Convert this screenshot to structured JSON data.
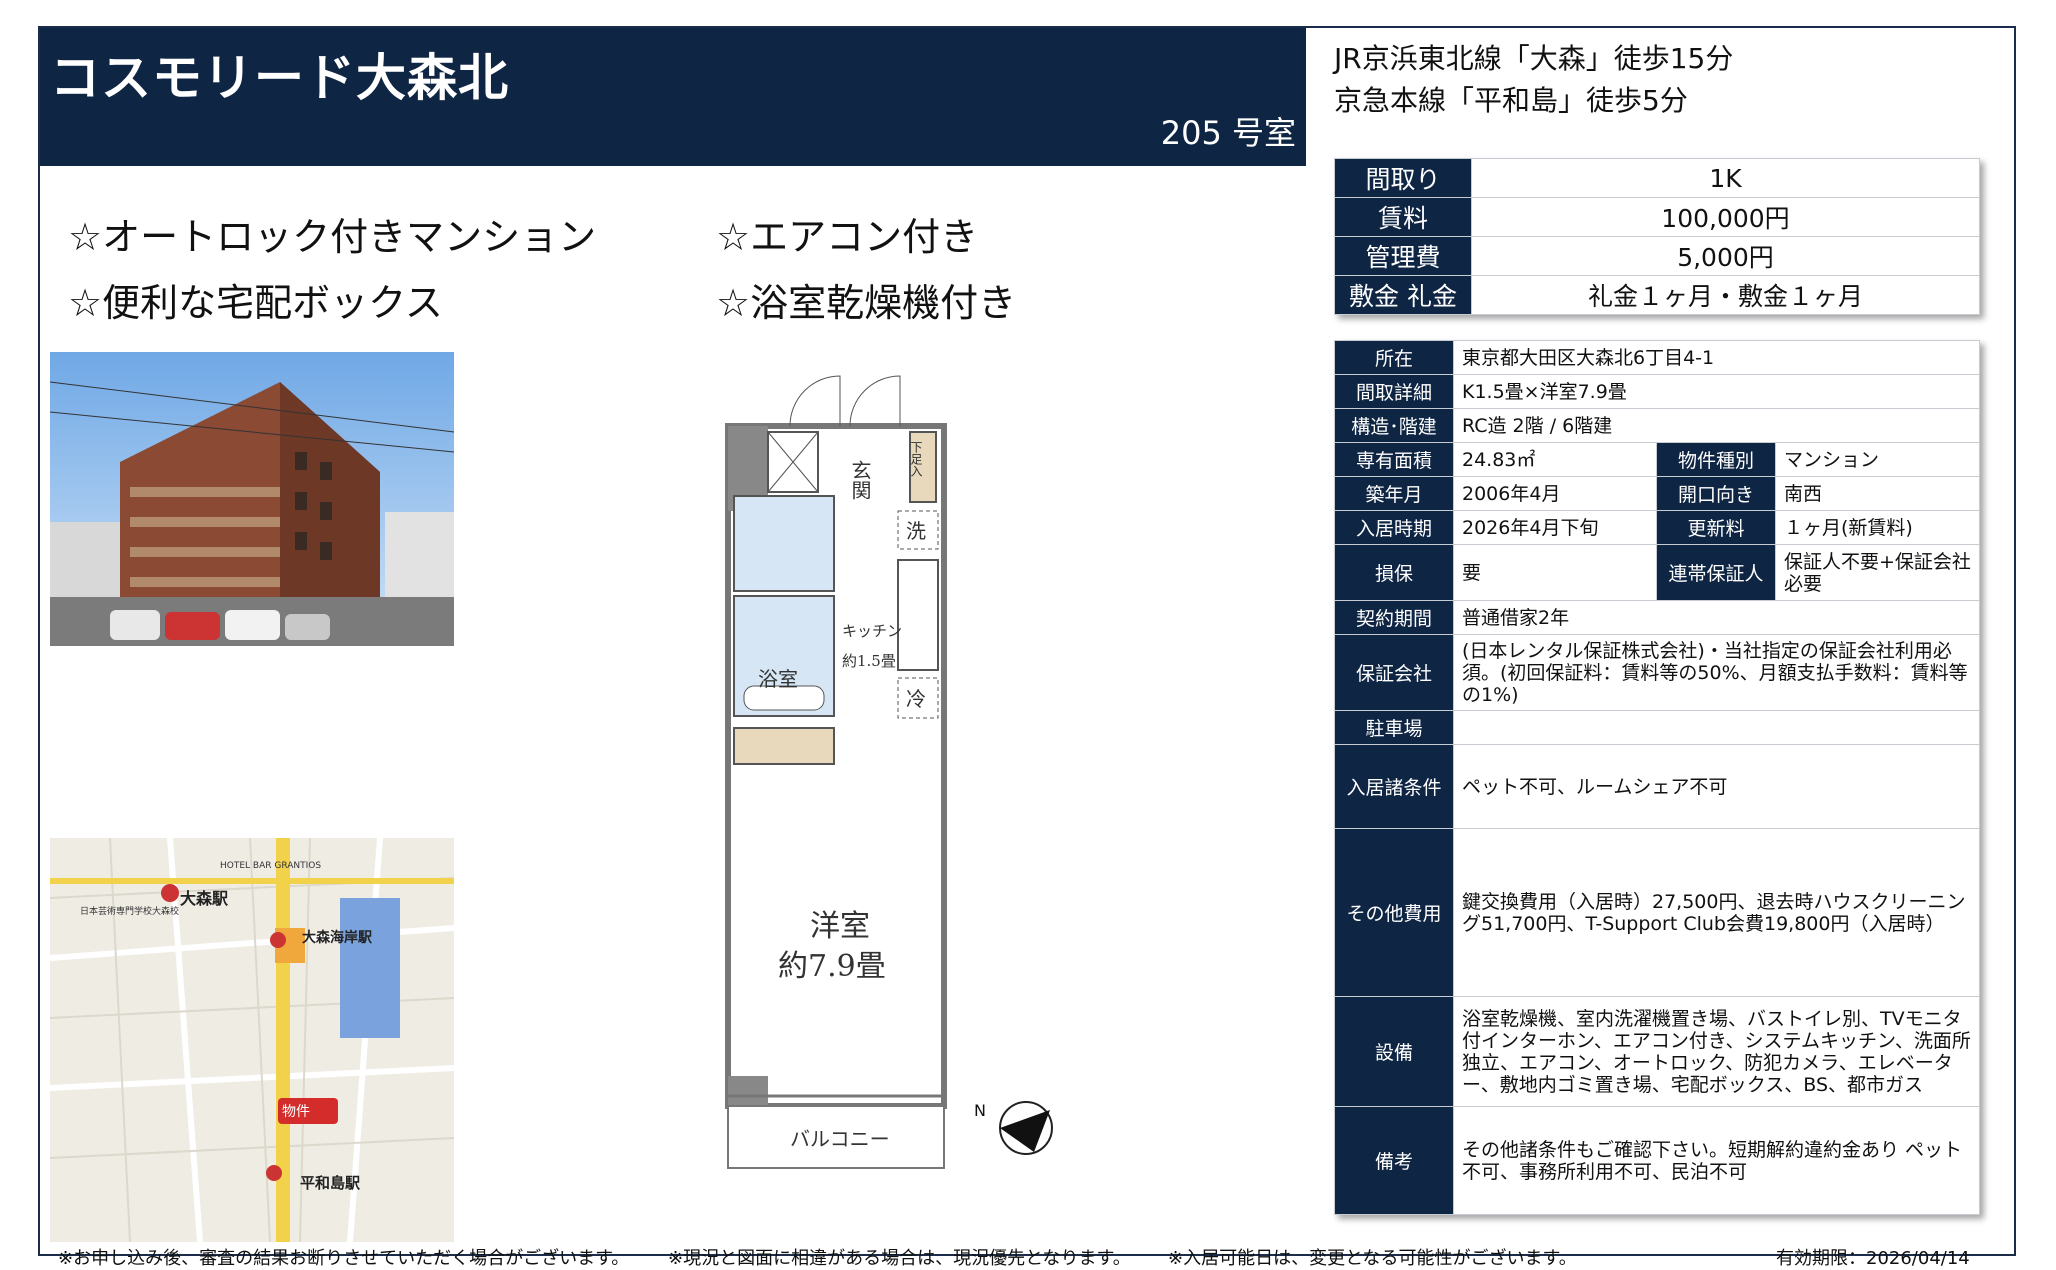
{
  "header": {
    "title": "コスモリード大森北",
    "room": "205 号室"
  },
  "access": [
    "JR京浜東北線「大森」徒歩15分",
    "京急本線「平和島」徒歩5分"
  ],
  "features": [
    "☆オートロック付きマンション",
    "☆エアコン付き",
    "☆便利な宅配ボックス",
    "☆浴室乾燥機付き"
  ],
  "summary": [
    {
      "label": "間取り",
      "value": "1K"
    },
    {
      "label": "賃料",
      "value": "100,000円"
    },
    {
      "label": "管理費",
      "value": "5,000円"
    },
    {
      "label": "敷金 礼金",
      "value": "礼金１ヶ月・敷金１ヶ月"
    }
  ],
  "details": {
    "address": {
      "label": "所在",
      "value": "東京都大田区大森北6丁目4-1"
    },
    "layout_detail": {
      "label": "間取詳細",
      "value": "K1.5畳×洋室7.9畳"
    },
    "structure": {
      "label": "構造･階建",
      "value": "RC造 2階 / 6階建"
    },
    "area": {
      "label": "専有面積",
      "value": "24.83㎡"
    },
    "type": {
      "label": "物件種別",
      "value": "マンション"
    },
    "built": {
      "label": "築年月",
      "value": "2006年4月"
    },
    "direction": {
      "label": "開口向き",
      "value": "南西"
    },
    "move_in": {
      "label": "入居時期",
      "value": "2026年4月下旬"
    },
    "renewal": {
      "label": "更新料",
      "value": "１ヶ月(新賃料)"
    },
    "insurance": {
      "label": "損保",
      "value": "要"
    },
    "guarantor": {
      "label": "連帯保証人",
      "value": "保証人不要+保証会社必要"
    },
    "contract": {
      "label": "契約期間",
      "value": "普通借家2年"
    },
    "guarantee_company": {
      "label": "保証会社",
      "value": "(日本レンタル保証株式会社)・当社指定の保証会社利用必須。(初回保証料：賃料等の50%、月額支払手数料：賃料等の1%)"
    },
    "parking": {
      "label": "駐車場",
      "value": ""
    },
    "conditions": {
      "label": "入居諸条件",
      "value": "ペット不可、ルームシェア不可"
    },
    "other_costs": {
      "label": "その他費用",
      "value": "鍵交換費用（入居時）27,500円、退去時ハウスクリーニング51,700円、T-Support Club会費19,800円（入居時）"
    },
    "equipment": {
      "label": "設備",
      "value": "浴室乾燥機、室内洗濯機置き場、バストイレ別、TVモニタ付インターホン、エアコン付き、システムキッチン、洗面所独立、エアコン、オートロック、防犯カメラ、エレベーター、敷地内ゴミ置き場、宅配ボックス、BS、都市ガス"
    },
    "remarks": {
      "label": "備考",
      "value": "その他諸条件もご確認下さい。短期解約違約金あり ペット不可、事務所利用不可、民泊不可"
    }
  },
  "floorplan": {
    "entrance": "玄関",
    "shoebox": "下足入",
    "washer": "洗",
    "kitchen": "キッチン",
    "kitchen_size": "約1.5畳",
    "fridge": "冷",
    "bath": "浴室",
    "room": "洋室",
    "room_size": "約7.9畳",
    "balcony": "バルコニー"
  },
  "map": {
    "station1": "大森駅",
    "station2": "大森海岸駅",
    "station3": "平和島駅",
    "property": "物件",
    "hotel": "HOTEL BAR GRANTIOS",
    "school": "日本芸術専門学校大森校"
  },
  "footer": {
    "note1": "※お申し込み後、審査の結果お断りさせていただく場合がございます。",
    "note2": "※現況と図面に相違がある場合は、現況優先となります。",
    "note3": "※入居可能日は、変更となる可能性がございます。",
    "validity": "有効期限：2026/04/14"
  },
  "colors": {
    "navy": "#0f2544",
    "map_yellow": "#f2d14b",
    "map_water": "#7aa3dd",
    "brick": "#8a4a34"
  }
}
